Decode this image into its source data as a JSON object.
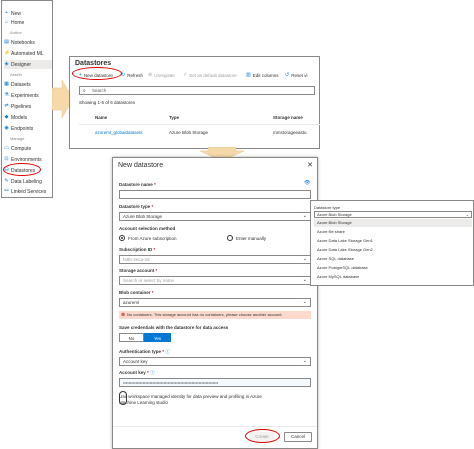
{
  "nav": {
    "items": [
      {
        "label": "New",
        "icon": "plus-icon",
        "glyph": "+"
      },
      {
        "label": "Home",
        "icon": "home-icon",
        "glyph": "⌂"
      },
      {
        "label": "Notebooks",
        "icon": "notebook-icon",
        "glyph": "▤"
      },
      {
        "label": "Automated ML",
        "icon": "automl-icon",
        "glyph": "⚡"
      },
      {
        "label": "Designer",
        "icon": "designer-icon",
        "glyph": "◈"
      },
      {
        "label": "Datasets",
        "icon": "datasets-icon",
        "glyph": "▦"
      },
      {
        "label": "Experiments",
        "icon": "experiments-icon",
        "glyph": "⚗"
      },
      {
        "label": "Pipelines",
        "icon": "pipelines-icon",
        "glyph": "⇌"
      },
      {
        "label": "Models",
        "icon": "models-icon",
        "glyph": "◆"
      },
      {
        "label": "Endpoints",
        "icon": "endpoints-icon",
        "glyph": "◉"
      },
      {
        "label": "Compute",
        "icon": "compute-icon",
        "glyph": "▭"
      },
      {
        "label": "Environments",
        "icon": "environments-icon",
        "glyph": "⊡"
      },
      {
        "label": "Datastores",
        "icon": "datastores-icon",
        "glyph": "⛁"
      },
      {
        "label": "Data Labeling",
        "icon": "labeling-icon",
        "glyph": "✎"
      },
      {
        "label": "Linked Services",
        "icon": "linked-services-icon",
        "glyph": "⚯"
      }
    ],
    "sections": [
      "Author",
      "Assets",
      "Manage"
    ]
  },
  "datastores": {
    "title": "Datastores",
    "toolbar": {
      "new": "New datastore",
      "refresh": "Refresh",
      "unregister": "Unregister",
      "set_default": "Set as default datastore",
      "edit_columns": "Edit columns",
      "reset": "Reset vi"
    },
    "search_placeholder": "Search",
    "count": "Showing 1-6 of 6 datastores",
    "columns": [
      "Name",
      "Type",
      "Storage name"
    ],
    "row": {
      "name": "azureml_globaldatasets",
      "type": "Azure Blob Storage",
      "storage": "mmstorageeastu"
    }
  },
  "dialog": {
    "title": "New datastore",
    "close": "✕",
    "name_label": "Datastore name",
    "type_label": "Datastore type",
    "type_value": "Azure Blob Storage",
    "account_selection_label": "Account selection method",
    "from_sub": "From Azure subscription",
    "enter_manually": "Enter manually",
    "sub_label": "Subscription ID",
    "sub_value": "fa9b-4eca-2d",
    "storage_label": "Storage account",
    "storage_placeholder": "Search or select by name",
    "blob_label": "Blob container",
    "blob_value": "azureml",
    "warning": "No containers. This storage account has no containers, please choose another account.",
    "save_cred_label": "Save credentials with the datastore for data access",
    "no": "No",
    "yes": "Yes",
    "auth_label": "Authentication type",
    "auth_value": "Account key",
    "key_label": "Account key",
    "key_value": "••••••••••••••••••••••••••••••••••••••••••••••••••••••••••••••••••••",
    "identity_text": "Use workspace managed identity for data preview and profiling in Azure Machine Learning studio",
    "create": "Create",
    "cancel": "Cancel"
  },
  "dropdown": {
    "label": "Datastore type",
    "selected": "Azure Blob Storage",
    "options": [
      "Azure Blob Storage",
      "Azure file share",
      "Azure Data Lake Storage Gen1",
      "Azure Data Lake Storage Gen2",
      "Azure SQL database",
      "Azure PostgreSQL database",
      "Azure MySQL database"
    ]
  },
  "colors": {
    "accent": "#0078d4",
    "highlight": "#dd0000",
    "warning_bg": "#fed9cc",
    "arrow": "#f5d9a8"
  }
}
